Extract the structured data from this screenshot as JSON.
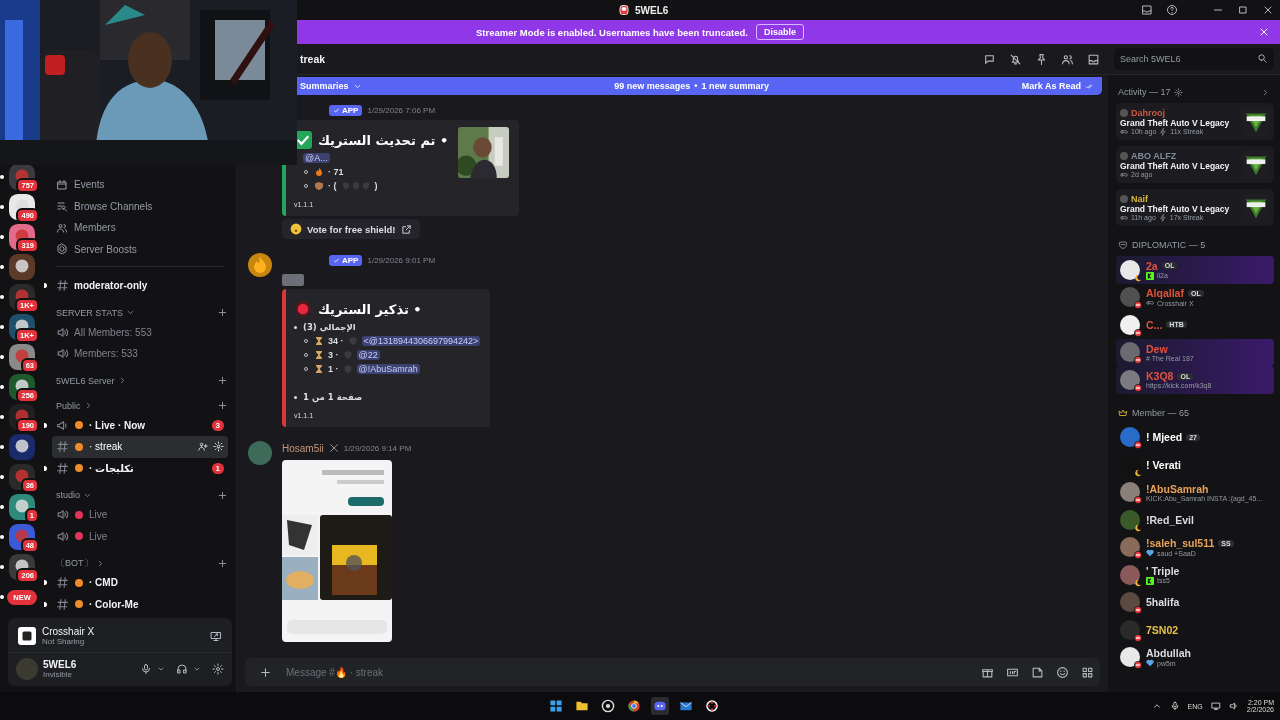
{
  "window": {
    "title": "5WEL6"
  },
  "banner": {
    "text": "Streamer Mode is enabled. Usernames have been truncated.",
    "button": "Disable"
  },
  "servers": [
    {
      "badge": "757",
      "unread": true
    },
    {
      "badge": "490",
      "unread": true
    },
    {
      "badge": "319",
      "unread": true
    },
    {
      "unread": true
    },
    {
      "badge": "1K+",
      "unread": true
    },
    {
      "badge": "1K+",
      "unread": true
    },
    {
      "badge": "63",
      "unread": true
    },
    {
      "badge": "256",
      "unread": true
    },
    {
      "badge": "190",
      "unread": true
    },
    {
      "unread": true
    },
    {
      "badge": "36",
      "unread": true
    },
    {
      "badge": "1",
      "unread": true
    },
    {
      "badge": "48",
      "unread": true
    },
    {
      "badge": "206",
      "unread": true
    },
    {
      "pill": "NEW",
      "unread": true
    }
  ],
  "sidebar": {
    "nav": [
      {
        "kind": "events",
        "label": "Events"
      },
      {
        "kind": "browse",
        "label": "Browse Channels"
      },
      {
        "kind": "members",
        "label": "Members"
      },
      {
        "kind": "boosts",
        "label": "Server Boosts"
      }
    ],
    "sections": [
      {
        "channels": [
          {
            "kind": "text",
            "name": "moderator-only",
            "unread": true,
            "selected": false,
            "emoji": false
          }
        ]
      },
      {
        "name": "SERVER STATS",
        "expanded": true,
        "channels": [
          {
            "kind": "voice",
            "name": "All Members: 553",
            "unread": false,
            "selected": false,
            "emoji": false
          },
          {
            "kind": "voice",
            "name": "Members: 533",
            "unread": false,
            "selected": false,
            "emoji": false
          }
        ]
      },
      {
        "name": "5WEL6 Server",
        "expanded": false
      },
      {
        "name": "Public",
        "expanded": false,
        "channels": [
          {
            "kind": "announce",
            "name": "· Live · Now",
            "unread": true,
            "selected": false,
            "emoji": true,
            "badge": "3"
          },
          {
            "kind": "text",
            "name": "· streak",
            "unread": false,
            "selected": true,
            "emoji": true
          },
          {
            "kind": "text",
            "name": "· تكليجات",
            "unread": true,
            "selected": false,
            "emoji": true,
            "badge": "1"
          }
        ]
      },
      {
        "name": "studio",
        "expanded": true,
        "channels": [
          {
            "kind": "voice",
            "name": "Live",
            "unread": false,
            "selected": false,
            "emoji": true
          },
          {
            "kind": "voice",
            "name": "Live",
            "unread": false,
            "selected": false,
            "emoji": true
          }
        ]
      },
      {
        "name": "〔BOT〕",
        "expanded": false,
        "channels": [
          {
            "kind": "text",
            "name": "· CMD",
            "unread": true,
            "selected": false,
            "emoji": true
          },
          {
            "kind": "text",
            "name": "· Color-Me",
            "unread": true,
            "selected": false,
            "emoji": true
          }
        ]
      }
    ],
    "activity": {
      "title": "Crosshair X",
      "subtitle": "Not Sharing"
    },
    "user": {
      "name": "5WEL6",
      "status": "Invisible"
    }
  },
  "chat": {
    "channel": "treak",
    "summary_bar": {
      "label": "Summaries",
      "new_messages": "99 new messages",
      "separator": "•",
      "new_summary": "1 new summary",
      "mark_read": "Mark As Read"
    },
    "messages": [
      {
        "kind": "bot",
        "avatar": false,
        "tag": "APP",
        "time": "1/29/2026 7:06 PM",
        "embed": {
          "kind": "update",
          "color": "#23a55a",
          "title": "تم تحديث الستريك •",
          "mention": "@A...",
          "lines": [
            {
              "kind": "fire",
              "text": "· 71"
            },
            {
              "kind": "shield",
              "text": "· (",
              "close": ")"
            }
          ],
          "footer": "v1.1.1",
          "thumbnail": true
        },
        "button": "Vote for free shield!"
      },
      {
        "kind": "bot",
        "avatar": true,
        "tag": "APP",
        "time": "1/29/2026 9:01 PM",
        "redacted": true,
        "embed": {
          "kind": "reminder",
          "color": "#da373c",
          "title": "تذكير الستريك •",
          "total": "الإجمالي (3)",
          "rows": [
            {
              "count": "34 ·",
              "mention": "<@1318944306697994242>"
            },
            {
              "count": "3 ·",
              "mention": "@22"
            },
            {
              "count": "1 ·",
              "mention": "@!AbuSamrah"
            }
          ],
          "page": "صفحة 1 من 1",
          "footer": "v1.1.1"
        }
      },
      {
        "kind": "user",
        "author": "Hosam5ii",
        "color": "#c4977a",
        "time": "1/29/2026 9:14 PM"
      }
    ],
    "composer": {
      "placeholder": "Message #🔥 · streak"
    }
  },
  "members": {
    "search": {
      "placeholder": "Search 5WEL6"
    },
    "activity_header": "Activity — 17",
    "activities": [
      {
        "user": "Dahrooj",
        "color": "#c9583f",
        "game": "Grand Theft Auto V Legacy",
        "time": "10h ago",
        "streak": "11x Streak"
      },
      {
        "user": "ABO ALFZ",
        "color": "#7d8b99",
        "game": "Grand Theft Auto V Legacy",
        "time": "2d ago"
      },
      {
        "user": "Naif",
        "color": "#d7b53e",
        "game": "Grand Theft Auto V Legacy",
        "time": "11h ago",
        "streak": "17x Streak"
      }
    ],
    "groups": [
      {
        "kind": "role",
        "name": "DIPLOMATIC — 5",
        "members": [
          {
            "kind": "streaming",
            "name": "2a",
            "color": "#e0533d",
            "dnd": false,
            "tag": "OL",
            "subtitle": "ii2a",
            "banner": true
          },
          {
            "kind": "playing",
            "name": "Alqallaf",
            "color": "#e0533d",
            "dnd": true,
            "tag": "OL",
            "subtitle": "Crosshair X",
            "banner": false
          },
          {
            "name": "C...",
            "color": "#e0533d",
            "dnd": true,
            "tag": "HTB",
            "banner": false
          },
          {
            "kind": "plain",
            "name": "Dew",
            "color": "#e0533d",
            "dnd": true,
            "subtitle": "# The Real 187",
            "banner": true
          },
          {
            "kind": "plain",
            "name": "K3Q8",
            "color": "#e0533d",
            "dnd": true,
            "tag": "OL",
            "subtitle": "https://kick.com/k3q8",
            "banner": true
          }
        ]
      },
      {
        "kind": "members",
        "name": "Member — 65",
        "members": [
          {
            "name": "! Mjeed",
            "color": "#ffffff",
            "dnd": true,
            "tag": "27",
            "banner": false
          },
          {
            "name": "! Verati",
            "color": "#ffffff",
            "dnd": false,
            "banner": false
          },
          {
            "kind": "plain",
            "name": "!AbuSamrah",
            "color": "#e7a35a",
            "dnd": true,
            "subtitle": "KICK:Abu_Samrah INSTA :{agd_45...",
            "banner": false
          },
          {
            "name": "!Red_Evil",
            "color": "#dbdee1",
            "dnd": false,
            "banner": false
          },
          {
            "kind": "custom",
            "name": "!saleh_sul511",
            "color": "#e7a35a",
            "dnd": true,
            "tag": "SS",
            "subtitle": "saud +SaaD",
            "banner": false
          },
          {
            "kind": "streaming",
            "name": "' Triple",
            "color": "#dbdee1",
            "dnd": false,
            "subtitle": "tss5",
            "banner": false
          },
          {
            "name": "5halifa",
            "color": "#dbdee1",
            "dnd": true,
            "banner": false
          },
          {
            "name": "7SN02",
            "color": "#e5c04a",
            "dnd": true,
            "banner": false
          },
          {
            "kind": "custom",
            "name": "Abdullah",
            "color": "#dbdee1",
            "dnd": true,
            "subtitle": "pw5m",
            "banner": false
          }
        ]
      }
    ]
  },
  "taskbar": {
    "language": "ENG",
    "time": "2:20 PM",
    "date": "2/2/2026"
  }
}
